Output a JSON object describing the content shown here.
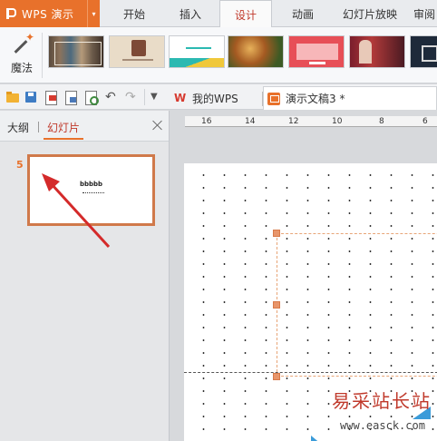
{
  "app": {
    "title": "WPS 演示"
  },
  "ribbon_tabs": [
    {
      "label": "开始"
    },
    {
      "label": "插入"
    },
    {
      "label": "设计",
      "active": true
    },
    {
      "label": "动画"
    },
    {
      "label": "幻灯片放映"
    },
    {
      "label": "审阅"
    }
  ],
  "ribbon": {
    "magic_label": "魔法",
    "themes": [
      "theme-1",
      "theme-2",
      "theme-3",
      "theme-4",
      "theme-5",
      "theme-6",
      "theme-7"
    ]
  },
  "toolbar": {
    "icons": [
      "folder-icon",
      "save-icon",
      "pdf-icon",
      "print-icon",
      "preview-icon",
      "undo-icon",
      "redo-icon",
      "more-icon"
    ],
    "doc_tabs": [
      {
        "label": "我的WPS"
      },
      {
        "label": "演示文稿3 *",
        "active": true
      }
    ]
  },
  "panel": {
    "tabs": [
      {
        "label": "大纲"
      },
      {
        "label": "幻灯片",
        "active": true
      }
    ],
    "slide_number": "5",
    "slide_text": "bbbbb"
  },
  "ruler": {
    "labels": [
      "16",
      "14",
      "12",
      "10",
      "8",
      "6"
    ]
  },
  "watermark": {
    "title": "易采站长站",
    "url": "www.easck.com"
  },
  "colors": {
    "accent": "#e8712b",
    "active_tab_text": "#c0392b",
    "arrow": "#d42a2a",
    "deco": "#3a9bd9"
  }
}
